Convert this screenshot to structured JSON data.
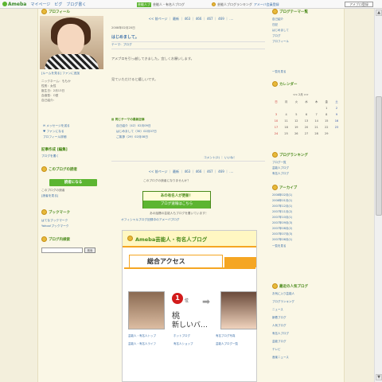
{
  "topbar": {
    "logo": "Ameba",
    "links": [
      "マイページ",
      "ピグ",
      "ブログ書く"
    ],
    "ad_tag": "芸能人ブ",
    "ad_text": "芸能人・有名人ブログ",
    "ad2_text": "芸能人ブログランキング",
    "ad2_text2": "アメーバ会員登録",
    "ameba_btn": "アメブロ登録"
  },
  "left": {
    "profile_head": "プロフィール",
    "profile_note": "[ルームを見る]",
    "profile_note2": "ファンに追加",
    "profile_lines": [
      "ニックネーム：ももか",
      "性別：女性",
      "誕生日：2月13日",
      "血液型：O型",
      "自己紹介："
    ],
    "msg_link": "メッセージを送る",
    "fan_link": "ファンになる",
    "more_link": "プロフィール詳細",
    "ranking_head": "記事作成 [編集]",
    "ranking_sub": "ブログを書く",
    "reader_head": "このブログの読者",
    "reader_btn": "読者になる",
    "reader_text": "このブログの読者",
    "reader_link": "[読者を見る]",
    "bookmark_head": "ブックマーク",
    "bookmark_items": [
      "はてなブックマーク",
      "Yahoo!ブックマーク"
    ],
    "search_head": "ブログ内検索",
    "search_btn": "検索"
  },
  "main": {
    "nav": "<< 前ページ ｜ 最新 ｜ 463 ｜ 466 ｜ 467 ｜ 469 ｜ ....",
    "date": "2008年02月20日",
    "entry_title": "はじめまして。",
    "theme": "テーマ：ブログ",
    "body1": "アメブロを引っ越してきました。宜しくお願いします。",
    "body2": "見ていただけると嬉しいです。",
    "related_head": "同じテーマの最新記事",
    "related": [
      "自己紹介（42）02月09日",
      "はじめまして（30）02月07日",
      "ご挨拶（29）02月08日"
    ],
    "comment": "コメント(2) ｜ いいね！",
    "reader_q": "このブログの読者になりませんか？",
    "banner_top": "あの有名人が更新！",
    "banner_btn": "ブログ速報はこちら",
    "promo1": "あの話題の芸能人もブログを書いています！",
    "promo2": "オフィシャルブログ記録中のアメーバブログ",
    "ameba_title": "Ameba芸能人・有名人ブログ",
    "ameba_tab": "総合アクセス",
    "rank": "1",
    "rank_pos": "位",
    "rank_name": "桃",
    "rank_desc": "新しいバ…",
    "rank_links": [
      "芸能人・有名人トップ",
      "ホットブログ",
      "有名ブログ写真",
      "芸能人・有名人ライフ",
      "有名人ショップ",
      "芸能人ブログ一覧"
    ]
  },
  "right": {
    "theme_head": "ブログテーマ一覧",
    "themes": [
      "自己紹介",
      "日記",
      "はじめまして",
      "ブログ",
      "プロフィール"
    ],
    "theme_more": "一覧を見る",
    "cal_head": "カレンダー",
    "cal_month": "<< 2月 >>",
    "cal_days": [
      "日",
      "月",
      "火",
      "水",
      "木",
      "金",
      "土"
    ],
    "cal_rows": [
      [
        "",
        "",
        "",
        "",
        "",
        "1",
        "2"
      ],
      [
        "3",
        "4",
        "5",
        "6",
        "7",
        "8",
        "9"
      ],
      [
        "10",
        "11",
        "12",
        "13",
        "14",
        "15",
        "16"
      ],
      [
        "17",
        "18",
        "19",
        "20",
        "21",
        "22",
        "23"
      ],
      [
        "24",
        "25",
        "26",
        "27",
        "28",
        "29",
        ""
      ]
    ],
    "rank_head": "ブログランキング",
    "rank_items": [
      "ブログ一覧",
      "芸能人ブログ",
      "有名人ブログ"
    ],
    "archive_head": "アーカイブ",
    "archives": [
      "2008年02月(1)",
      "2008年01月(1)",
      "2007年12月(1)",
      "2007年11月(2)",
      "2007年10月(1)",
      "2007年09月(3)",
      "2007年08月(2)",
      "2007年07月(3)",
      "2007年06月(1)"
    ],
    "archive_more": "一覧を見る",
    "recent_head": "最近の人気ブログ",
    "recent": [
      "お気に入り芸能人",
      "ブログランキング",
      "ニュース",
      "新着ブログ",
      "人気ブログ",
      "有名人ブログ",
      "芸能ブログ",
      "テレビ",
      "音楽ニュース"
    ]
  },
  "colors": {
    "accent": "#5cb531",
    "link": "#3a6ea8",
    "bg": "#f3efdc"
  }
}
